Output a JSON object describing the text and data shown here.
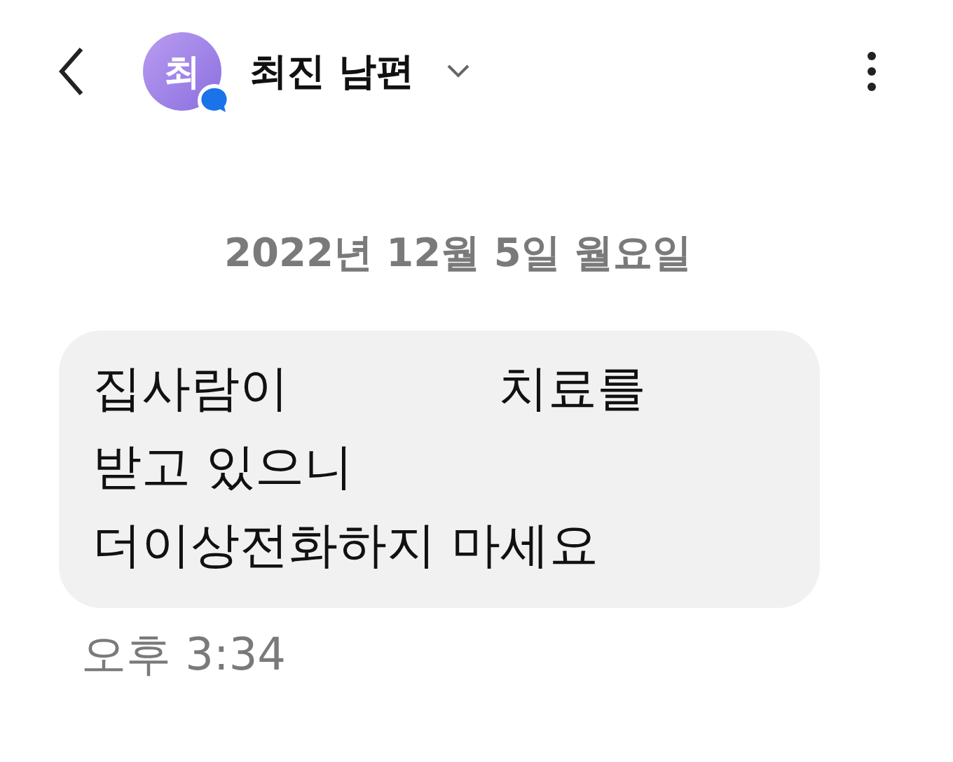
{
  "header": {
    "avatar_letter": "최",
    "name": "최진 남편"
  },
  "date": "2022년 12월 5일 월요일",
  "messages": [
    {
      "lines": [
        [
          "집사람이",
          "치료를"
        ],
        [
          "받고 있으니"
        ],
        [
          "더이상전화하지 마세요"
        ]
      ],
      "time": "오후 3:34"
    }
  ]
}
